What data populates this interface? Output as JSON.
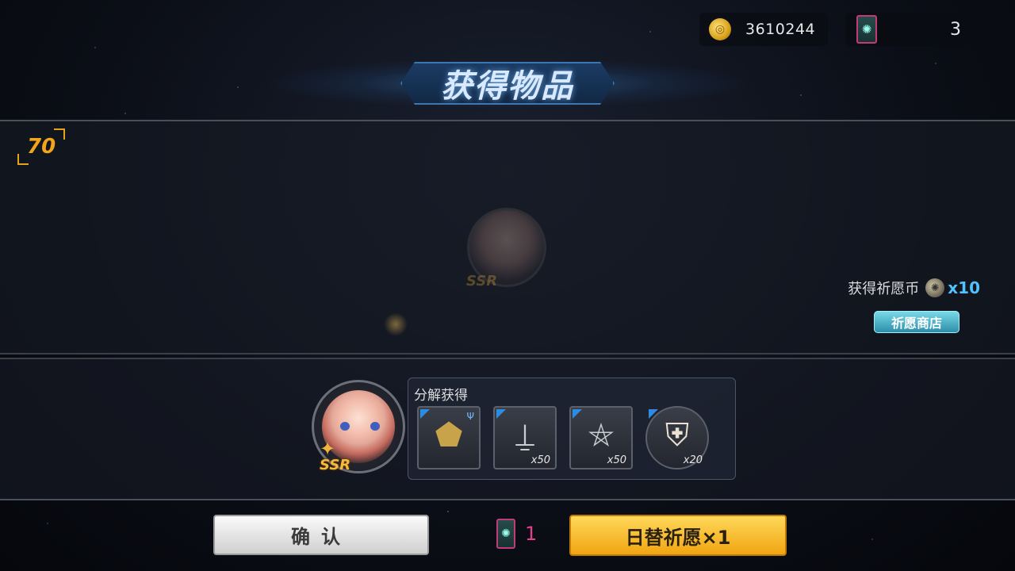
{
  "currency": {
    "gold_amount": "3610244",
    "ticket_amount": "3",
    "gold_icon": "gold-coin-icon",
    "ticket_icon": "wish-ticket-icon"
  },
  "title": "获得物品",
  "level": "70",
  "ghost": {
    "rarity": "SSR"
  },
  "wish_coin": {
    "label": "获得祈愿币",
    "qty": "x10",
    "icon": "wish-coin-icon"
  },
  "shop_button_label": "祈愿商店",
  "reward": {
    "rarity": "SSR",
    "decompose_title": "分解获得",
    "items": [
      {
        "icon": "badge-shield-icon",
        "qty": ""
      },
      {
        "icon": "red-lever-icon",
        "qty": "x50"
      },
      {
        "icon": "pentagram-stand-icon",
        "qty": "x50"
      },
      {
        "icon": "white-shield-icon",
        "qty": "x20"
      }
    ]
  },
  "buttons": {
    "confirm": "确认",
    "ticket_cost": "1",
    "wish": "日替祈愿×1"
  },
  "colors": {
    "gold": "#f0a51c",
    "ticket_border": "#c23a7a",
    "wish_qty": "#4fc2ff",
    "wish_button": "#f1a511"
  }
}
